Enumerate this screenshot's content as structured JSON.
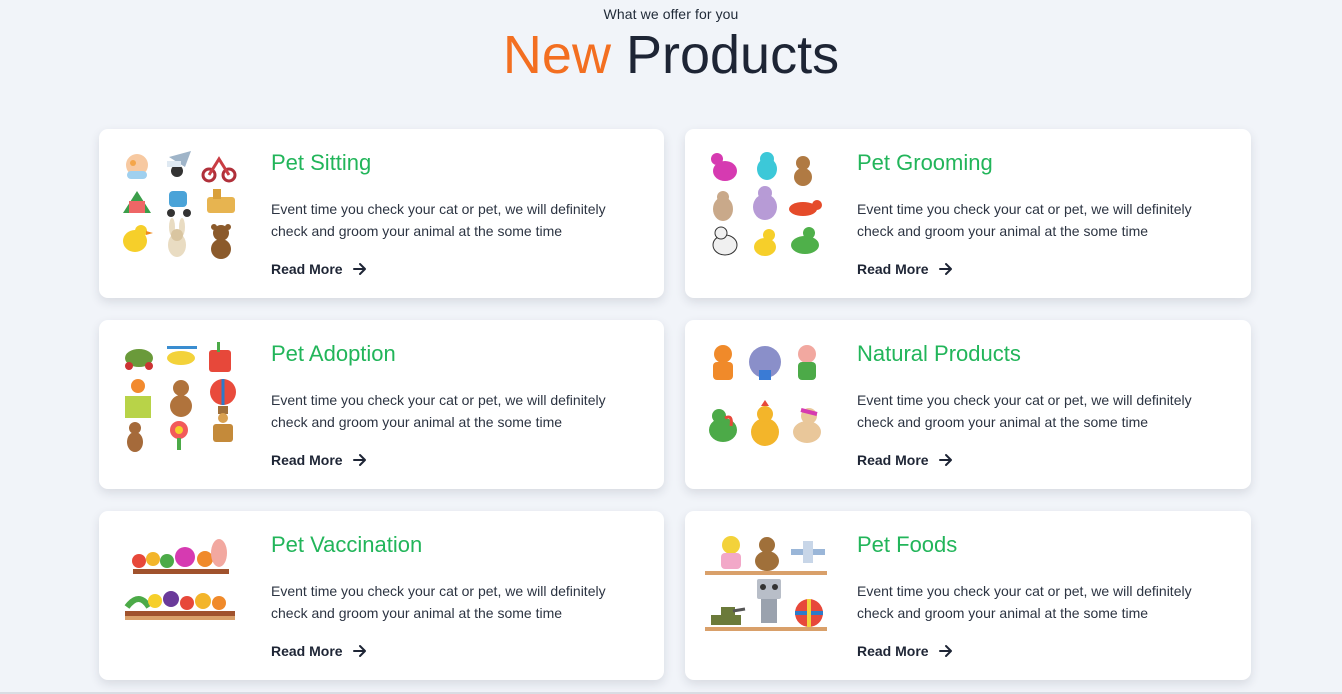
{
  "section": {
    "eyebrow": "What we offer for you",
    "title_accent": "New",
    "title_rest": "Products"
  },
  "colors": {
    "accent": "#f36f21",
    "card_title": "#22b55a",
    "heading": "#1e2535",
    "background": "#f1f4f9"
  },
  "cards": [
    {
      "title": "Pet Sitting",
      "description": "Event time you check your cat or pet, we will definitely check and groom your animal at the some time",
      "link_label": "Read More",
      "image": "toy-grid-sitting"
    },
    {
      "title": "Pet Grooming",
      "description": "Event time you check your cat or pet, we will definitely check and groom your animal at the some time",
      "link_label": "Read More",
      "image": "toy-grid-grooming"
    },
    {
      "title": "Pet Adoption",
      "description": "Event time you check your cat or pet, we will definitely check and groom your animal at the some time",
      "link_label": "Read More",
      "image": "toy-grid-adoption"
    },
    {
      "title": "Natural Products",
      "description": "Event time you check your cat or pet, we will definitely check and groom your animal at the some time",
      "link_label": "Read More",
      "image": "toy-grid-natural"
    },
    {
      "title": "Pet Vaccination",
      "description": "Event time you check your cat or pet, we will definitely check and groom your animal at the some time",
      "link_label": "Read More",
      "image": "toy-shelf-vaccination"
    },
    {
      "title": "Pet Foods",
      "description": "Event time you check your cat or pet, we will definitely check and groom your animal at the some time",
      "link_label": "Read More",
      "image": "toy-shelf-foods"
    }
  ]
}
